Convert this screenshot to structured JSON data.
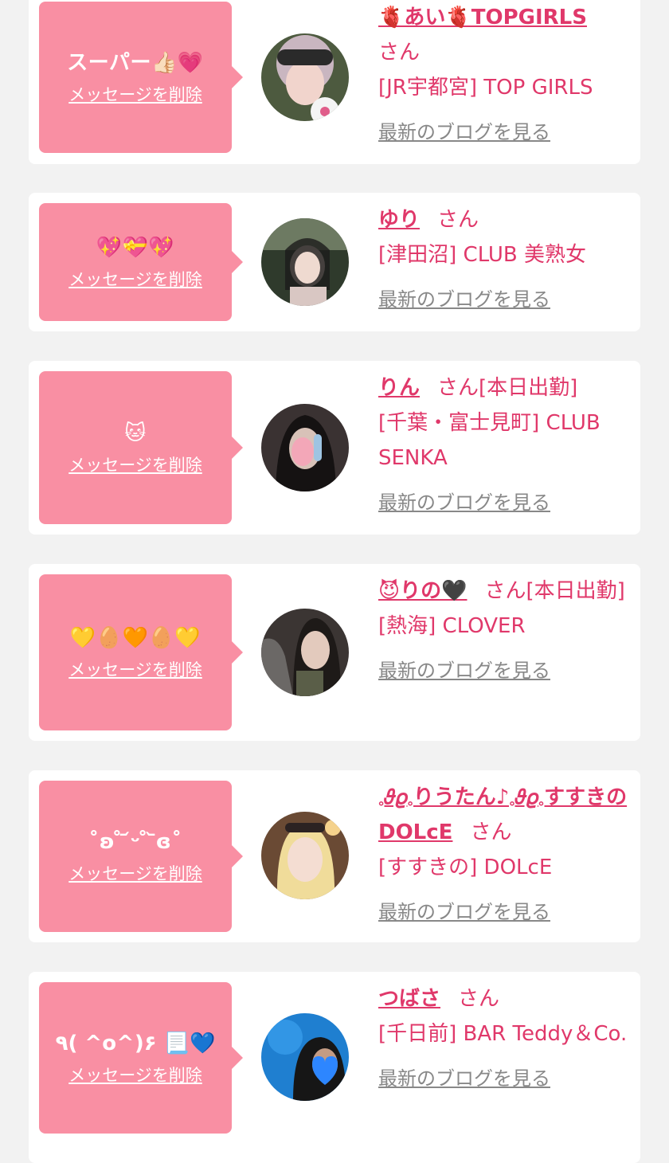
{
  "delete_label": "メッセージを削除",
  "blog_label": "最新のブログを見る",
  "san_label": "さん",
  "colors": {
    "bubble": "#f98fa3",
    "accent": "#e0386a",
    "link_gray": "#888888",
    "page_bg": "#f2f2f2"
  },
  "items": [
    {
      "message": "スーパー👍🏻💗",
      "name": "🫀あい🫀TOPGIRLS",
      "status": "",
      "shop": "[JR宇都宮] TOP GIRLS"
    },
    {
      "message": "💖💝💖",
      "name": "ゆり",
      "status": "",
      "shop": "[津田沼] CLUB 美熟女"
    },
    {
      "message": "🐱",
      "name": "りん",
      "status": "[本日出勤]",
      "shop": "[千葉・富士見町] CLUB SENKA"
    },
    {
      "message": "💛🥚🧡🥚💛",
      "name": "😈りの🖤",
      "status": "[本日出勤]",
      "shop": "[熱海] CLOVER"
    },
    {
      "message": "˚ʚ ̊ ᷄ᵕ ̊ ᷅ɞ˚",
      "name": "𓈒𝜗𝜚𓈒りうたん♪𓈒𝜗𝜚𓈒すすきのDOLcE",
      "status": "",
      "shop": "[すすきの] DOLcE"
    },
    {
      "message": "٩( ^o^)۶ 📃💙",
      "name": "つばさ",
      "status": "",
      "shop": "[千日前] BAR Teddy＆Co."
    }
  ]
}
